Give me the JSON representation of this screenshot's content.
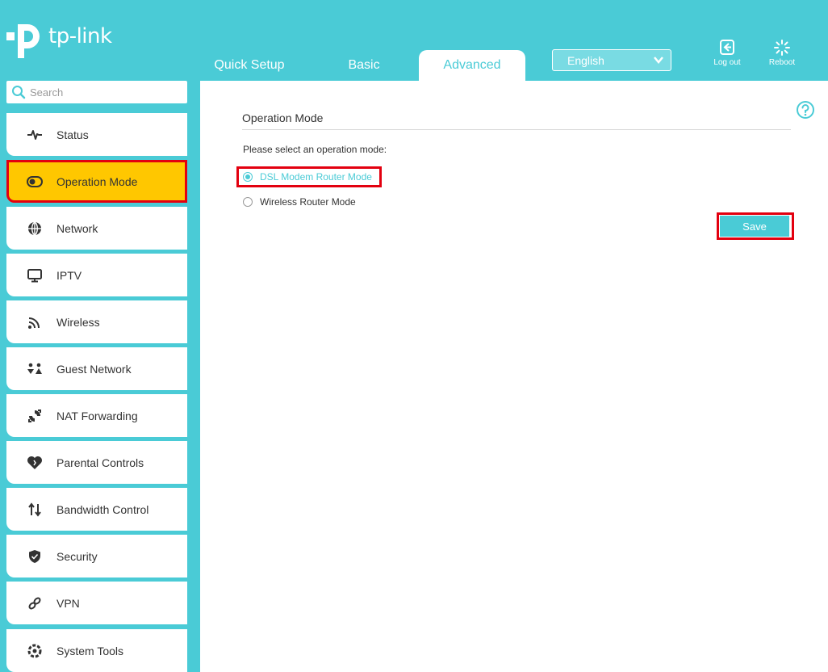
{
  "brand": {
    "name": "tp-link"
  },
  "tabs": [
    {
      "label": "Quick Setup"
    },
    {
      "label": "Basic"
    },
    {
      "label": "Advanced"
    }
  ],
  "language": {
    "selected": "English"
  },
  "header_buttons": {
    "logout": "Log out",
    "reboot": "Reboot"
  },
  "search": {
    "placeholder": "Search"
  },
  "sidebar": {
    "items": [
      {
        "label": "Status",
        "icon": "pulse-icon"
      },
      {
        "label": "Operation Mode",
        "icon": "toggle-icon"
      },
      {
        "label": "Network",
        "icon": "globe-icon"
      },
      {
        "label": "IPTV",
        "icon": "monitor-icon"
      },
      {
        "label": "Wireless",
        "icon": "wifi-icon"
      },
      {
        "label": "Guest Network",
        "icon": "guests-icon"
      },
      {
        "label": "NAT Forwarding",
        "icon": "nat-icon"
      },
      {
        "label": "Parental Controls",
        "icon": "heart-icon"
      },
      {
        "label": "Bandwidth Control",
        "icon": "updown-arrows-icon"
      },
      {
        "label": "Security",
        "icon": "shield-icon"
      },
      {
        "label": "VPN",
        "icon": "link-icon"
      },
      {
        "label": "System Tools",
        "icon": "gear-icon"
      }
    ],
    "active": "Operation Mode"
  },
  "main": {
    "title": "Operation Mode",
    "prompt": "Please select an operation mode:",
    "options": [
      {
        "label": "DSL Modem Router Mode",
        "checked": true
      },
      {
        "label": "Wireless Router Mode",
        "checked": false
      }
    ],
    "save_label": "Save"
  },
  "colors": {
    "accent": "#4acbd6",
    "active_nav": "#ffc700",
    "highlight_border": "#e3000f"
  }
}
